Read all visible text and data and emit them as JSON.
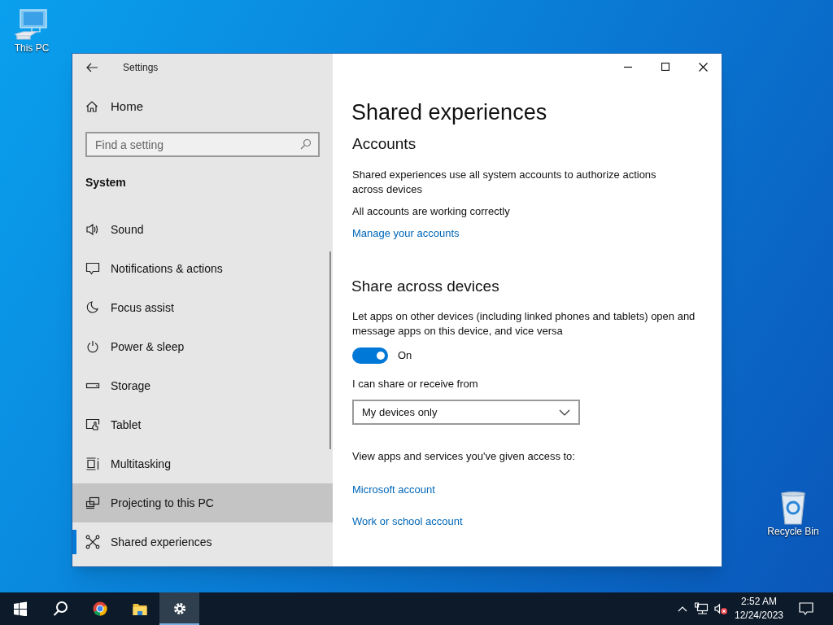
{
  "desktop_icons": [
    {
      "label": "This PC"
    },
    {
      "label": "Recycle Bin"
    }
  ],
  "window": {
    "title": "Settings",
    "sidebar": {
      "home": "Home",
      "search": {
        "placeholder": "Find a setting"
      },
      "section": "System",
      "items": [
        {
          "label": "Sound",
          "selected": false,
          "hovered": false
        },
        {
          "label": "Notifications & actions",
          "selected": false,
          "hovered": false
        },
        {
          "label": "Focus assist",
          "selected": false,
          "hovered": false
        },
        {
          "label": "Power & sleep",
          "selected": false,
          "hovered": false
        },
        {
          "label": "Storage",
          "selected": false,
          "hovered": false
        },
        {
          "label": "Tablet",
          "selected": false,
          "hovered": false
        },
        {
          "label": "Multitasking",
          "selected": false,
          "hovered": false
        },
        {
          "label": "Projecting to this PC",
          "selected": false,
          "hovered": true
        },
        {
          "label": "Shared experiences",
          "selected": true,
          "hovered": false
        }
      ]
    },
    "content": {
      "title": "Shared experiences",
      "accounts": {
        "heading": "Accounts",
        "description": "Shared experiences use all system accounts to authorize actions across devices",
        "status": "All accounts are working correctly",
        "link": "Manage your accounts"
      },
      "share": {
        "heading": "Share across devices",
        "description": "Let apps on other devices (including linked phones and tablets) open and message apps on this device, and vice versa",
        "toggle": {
          "on": true,
          "label": "On"
        },
        "dropdown_label": "I can share or receive from",
        "dropdown_value": "My devices only",
        "access_label": "View apps and services you've given access to:",
        "links": [
          "Microsoft account",
          "Work or school account"
        ]
      }
    }
  },
  "taskbar": {
    "apps": [
      {
        "kind": "start"
      },
      {
        "kind": "search"
      },
      {
        "kind": "browser",
        "selected": false
      },
      {
        "kind": "folder",
        "selected": false
      },
      {
        "kind": "settings",
        "selected": true
      }
    ],
    "time": "2:52 AM",
    "date": "12/24/2023"
  }
}
